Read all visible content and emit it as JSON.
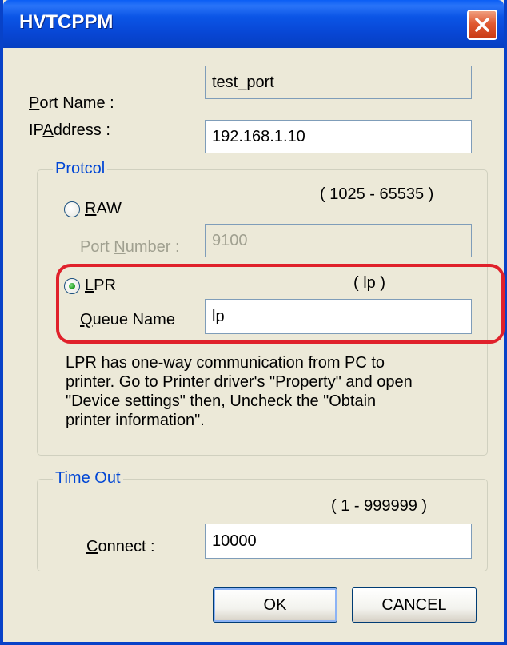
{
  "window": {
    "title": "HVTCPPM",
    "close_icon": "close-x-icon"
  },
  "port_name": {
    "label_prefix": "",
    "label_mnemonic": "P",
    "label_rest": "ort Name :",
    "value": "test_port"
  },
  "ip_address": {
    "label_prefix": "IP",
    "label_mnemonic": "A",
    "label_rest": "ddress :",
    "value": "192.168.1.10"
  },
  "protocol": {
    "legend": "Protcol",
    "raw": {
      "mnemonic": "R",
      "rest": "AW",
      "selected": false,
      "range": "( 1025 - 65535 )",
      "port_label_prefix": "Port ",
      "port_label_mnemonic": "N",
      "port_label_rest": "umber :",
      "port_value": "9100"
    },
    "lpr": {
      "mnemonic": "L",
      "rest": "PR",
      "selected": true,
      "hint": "( lp )",
      "queue_label_mnemonic": "Q",
      "queue_label_rest": "ueue Name",
      "queue_value": "lp"
    },
    "note_lines": [
      "LPR has one-way communication from PC to",
      "printer. Go to Printer driver's \"Property\" and open",
      "\"Device settings\" then, Uncheck the \"Obtain",
      "printer information\"."
    ]
  },
  "timeout": {
    "legend": "Time Out",
    "range": "( 1 - 999999 )",
    "connect_mnemonic": "C",
    "connect_rest": "onnect :",
    "connect_value": "10000"
  },
  "buttons": {
    "ok": "OK",
    "cancel": "CANCEL"
  },
  "colors": {
    "title_bar": "#0a5ef5",
    "legend_text": "#0046d5",
    "highlight": "#e0212b",
    "dialog_bg": "#ece9d8"
  }
}
